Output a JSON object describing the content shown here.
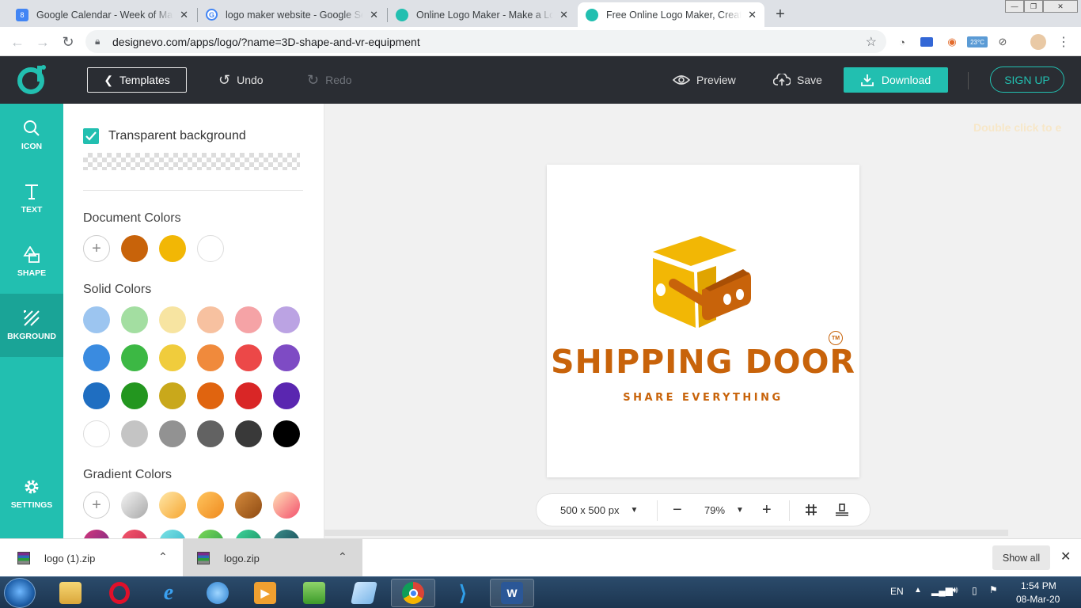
{
  "browser": {
    "tabs": [
      {
        "title": "Google Calendar - Week of March",
        "favicon": "calendar-icon",
        "color": "#4285f4",
        "badge": "8",
        "active": false
      },
      {
        "title": "logo maker website - Google Search",
        "favicon": "google-icon",
        "color": "#ffffff",
        "badge": "",
        "active": false
      },
      {
        "title": "Online Logo Maker - Make a Logo",
        "favicon": "designevo-icon",
        "color": "#22bfb0",
        "badge": "",
        "active": false
      },
      {
        "title": "Free Online Logo Maker, Create Custom",
        "favicon": "designevo-icon",
        "color": "#22bfb0",
        "badge": "",
        "active": true
      }
    ],
    "new_tab": "+",
    "url": "designevo.com/apps/logo/?name=3D-shape-and-vr-equipment",
    "weather_badge": "23°C"
  },
  "app_header": {
    "templates_label": "Templates",
    "undo_label": "Undo",
    "redo_label": "Redo",
    "preview_label": "Preview",
    "save_label": "Save",
    "download_label": "Download",
    "signup_label": "SIGN UP"
  },
  "left_nav": {
    "items": [
      {
        "label": "ICON",
        "icon": "search-icon"
      },
      {
        "label": "TEXT",
        "icon": "text-icon"
      },
      {
        "label": "SHAPE",
        "icon": "shape-icon"
      },
      {
        "label": "BKGROUND",
        "icon": "background-icon",
        "active": true
      },
      {
        "label": "SETTINGS",
        "icon": "gear-icon"
      }
    ]
  },
  "panel": {
    "transparent_label": "Transparent background",
    "transparent_checked": true,
    "document_colors_title": "Document Colors",
    "document_colors": [
      "#c8630a",
      "#f2b705",
      "#ffffff"
    ],
    "solid_colors_title": "Solid Colors",
    "solid_colors": [
      [
        "#9cc5f0",
        "#a3dea1",
        "#f7e4a1",
        "#f7c1a0",
        "#f5a3a6",
        "#bba3e3"
      ],
      [
        "#3a8be0",
        "#3cb844",
        "#f0cc3c",
        "#f08a3c",
        "#ec4848",
        "#7e4bc4"
      ],
      [
        "#1f6ec1",
        "#23961f",
        "#c9a81b",
        "#e0640f",
        "#d92626",
        "#5a26b0"
      ],
      [
        "#ffffff",
        "#c4c4c4",
        "#929292",
        "#626262",
        "#393939",
        "#000000"
      ]
    ],
    "gradient_colors_title": "Gradient Colors"
  },
  "canvas": {
    "hint": "Double click to e",
    "brand_name": "SHIPPING DOOR",
    "tagline": "SHARE EVERYTHING",
    "trademark": "TM",
    "logo_colors": {
      "primary": "#c8630a",
      "secondary": "#f2b705"
    },
    "size_label": "500 x 500 px",
    "zoom_label": "79%"
  },
  "downloads": {
    "items": [
      {
        "name": "logo (1).zip"
      },
      {
        "name": "logo.zip"
      }
    ],
    "show_all": "Show all"
  },
  "taskbar": {
    "language": "EN",
    "time": "1:54 PM",
    "date": "08-Mar-20"
  }
}
